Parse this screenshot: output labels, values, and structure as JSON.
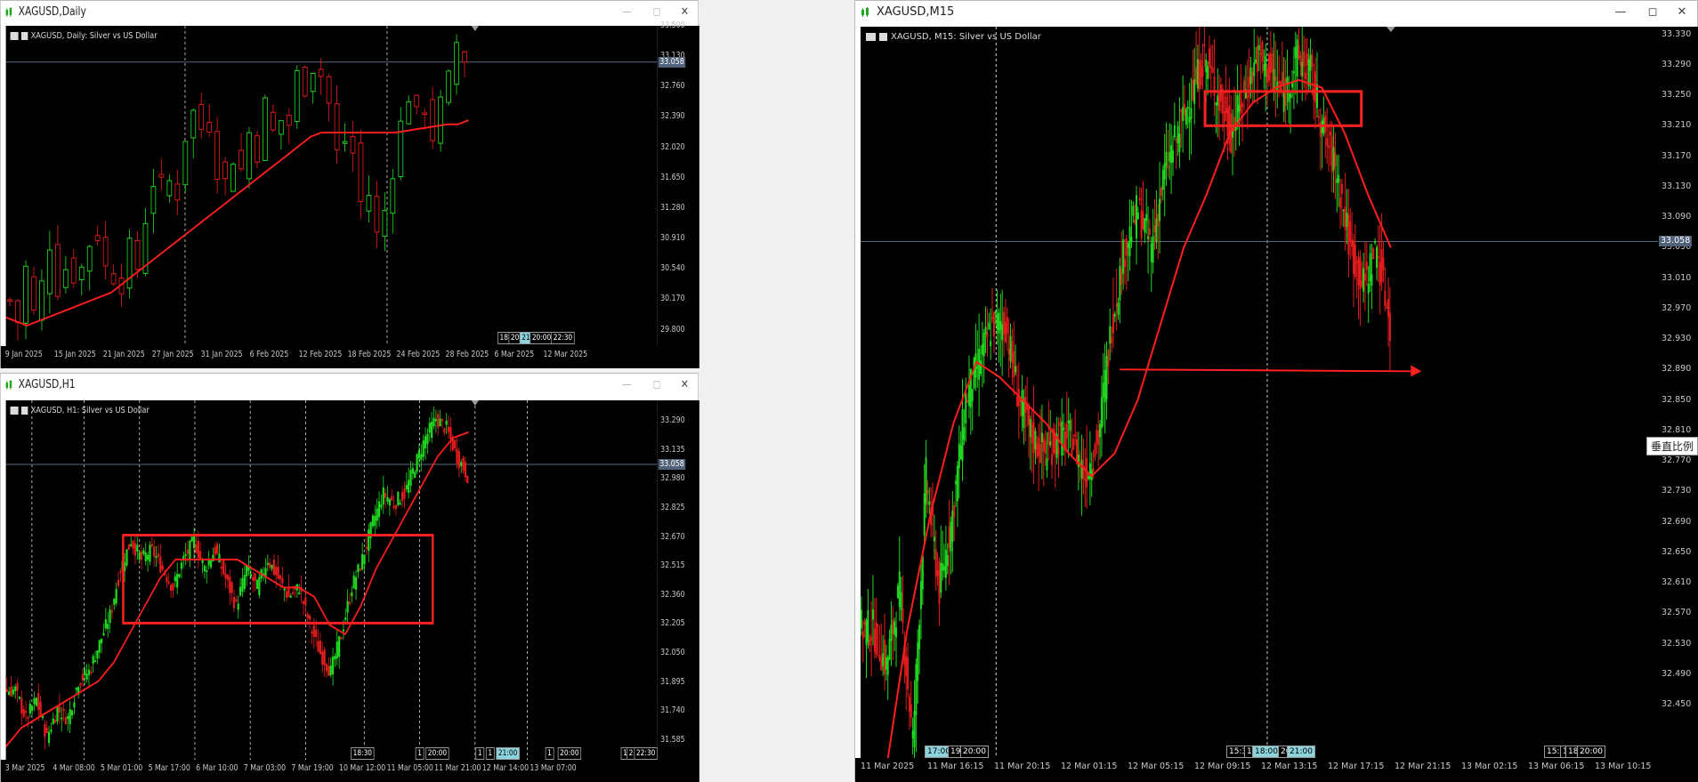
{
  "colors": {
    "bull": "#21d821",
    "bear": "#e21c1c",
    "ma": "#ff1e1e",
    "box": "#ff2020",
    "priceline": "#5a6a82"
  },
  "windows": {
    "daily": {
      "title": "XAGUSD,Daily",
      "symbol_label": "XAGUSD, Daily:  Silver vs US Dollar",
      "price_tag": "33.058",
      "y_ticks": [
        "33.500",
        "33.130",
        "32.760",
        "32.390",
        "32.020",
        "31.650",
        "31.280",
        "30.910",
        "30.540",
        "30.170",
        "29.800"
      ],
      "x_ticks": [
        "9 Jan 2025",
        "15 Jan 2025",
        "21 Jan 2025",
        "27 Jan 2025",
        "31 Jan 2025",
        "6 Feb 2025",
        "12 Feb 2025",
        "18 Feb 2025",
        "24 Feb 2025",
        "28 Feb 2025",
        "6 Mar 2025",
        "12 Mar 2025"
      ],
      "time_tags": [
        "18:",
        "20:",
        "21:",
        "20:00",
        "22:30"
      ]
    },
    "h1": {
      "title": "XAGUSD,H1",
      "symbol_label": "XAGUSD, H1:  Silver vs US Dollar",
      "price_tag": "33.058",
      "y_ticks": [
        "33.290",
        "33.135",
        "32.980",
        "32.825",
        "32.670",
        "32.515",
        "32.360",
        "32.205",
        "32.050",
        "31.895",
        "31.740",
        "31.585"
      ],
      "x_ticks": [
        "3 Mar 2025",
        "4 Mar 08:00",
        "5 Mar 01:00",
        "5 Mar 17:00",
        "6 Mar 10:00",
        "7 Mar 03:00",
        "7 Mar 19:00",
        "10 Mar 12:00",
        "11 Mar 05:00",
        "11 Mar 21:00",
        "12 Mar 14:00",
        "13 Mar 07:00"
      ],
      "time_tags": [
        "18:30",
        "1",
        "20:00",
        "1",
        "1",
        "21:00",
        "1",
        "20:00",
        "17",
        "2",
        "22:30"
      ]
    },
    "m15": {
      "title": "XAGUSD,M15",
      "symbol_label": "XAGUSD, M15:  Silver vs US Dollar",
      "price_tag": "33.058",
      "y_ticks": [
        "33.330",
        "33.290",
        "33.250",
        "33.210",
        "33.170",
        "33.130",
        "33.090",
        "33.050",
        "33.010",
        "32.970",
        "32.930",
        "32.890",
        "32.850",
        "32.810",
        "32.770",
        "32.730",
        "32.690",
        "32.650",
        "32.610",
        "32.570",
        "32.530",
        "32.490",
        "32.450"
      ],
      "x_ticks": [
        "11 Mar 2025",
        "11 Mar 16:15",
        "11 Mar 20:15",
        "12 Mar 01:15",
        "12 Mar 05:15",
        "12 Mar 09:15",
        "12 Mar 13:15",
        "12 Mar 17:15",
        "12 Mar 21:15",
        "13 Mar 02:15",
        "13 Mar 06:15",
        "13 Mar 10:15"
      ],
      "time_tags": [
        "17:00",
        "19:",
        "20:00",
        "15:30",
        "1",
        "18:00",
        "20:",
        "21:00",
        "15:30",
        "1",
        "18:30",
        "20:00"
      ],
      "tooltip": "垂直比例"
    }
  },
  "chart_data": [
    {
      "type": "candlestick",
      "symbol": "XAGUSD",
      "timeframe": "Daily",
      "y_range": [
        29.6,
        33.5
      ],
      "closes": [
        30.15,
        29.9,
        30.55,
        30.0,
        30.35,
        30.85,
        30.3,
        30.55,
        30.45,
        30.55,
        30.85,
        30.95,
        30.55,
        30.45,
        30.35,
        30.8,
        30.55,
        31.15,
        31.6,
        31.55,
        31.6,
        31.45,
        32.15,
        32.45,
        32.25,
        32.3,
        31.75,
        31.6,
        31.9,
        31.75,
        32.2,
        31.95,
        32.55,
        32.2,
        32.35,
        32.3,
        32.9,
        32.75,
        33.0,
        32.9,
        32.55,
        31.95,
        32.1,
        31.95,
        31.35,
        31.45,
        30.95,
        31.25,
        31.75,
        32.3,
        32.65,
        32.4,
        32.5,
        32.15,
        32.55,
        32.85,
        33.3,
        33.1
      ],
      "ma": [
        29.95,
        29.9,
        29.85,
        29.9,
        29.95,
        30.0,
        30.05,
        30.1,
        30.15,
        30.2,
        30.25,
        30.35,
        30.45,
        30.55,
        30.65,
        30.75,
        30.85,
        30.95,
        31.05,
        31.15,
        31.25,
        31.35,
        31.45,
        31.55,
        31.65,
        31.75,
        31.85,
        31.95,
        32.05,
        32.15,
        32.2,
        32.2,
        32.2,
        32.2,
        32.2,
        32.2,
        32.2,
        32.2,
        32.22,
        32.24,
        32.26,
        32.28,
        32.3,
        32.3,
        32.35
      ],
      "current_price": 33.058
    },
    {
      "type": "candlestick",
      "symbol": "XAGUSD",
      "timeframe": "H1",
      "y_range": [
        31.48,
        33.4
      ],
      "closes": [
        31.85,
        31.7,
        31.8,
        31.6,
        31.75,
        31.7,
        31.9,
        31.95,
        32.1,
        32.25,
        32.5,
        32.65,
        32.55,
        32.6,
        32.5,
        32.4,
        32.55,
        32.65,
        32.5,
        32.6,
        32.45,
        32.3,
        32.5,
        32.4,
        32.55,
        32.45,
        32.35,
        32.4,
        32.2,
        32.05,
        31.95,
        32.15,
        32.4,
        32.55,
        32.75,
        32.9,
        32.85,
        32.9,
        33.05,
        33.2,
        33.3,
        33.25,
        33.1,
        33.0
      ],
      "ma": [
        31.55,
        31.65,
        31.7,
        31.75,
        31.8,
        31.85,
        31.9,
        32.0,
        32.15,
        32.3,
        32.45,
        32.55,
        32.55,
        32.55,
        32.55,
        32.55,
        32.5,
        32.45,
        32.4,
        32.4,
        32.35,
        32.2,
        32.15,
        32.3,
        32.5,
        32.65,
        32.8,
        32.95,
        33.1,
        33.2,
        33.23
      ],
      "box": {
        "y_top": 32.68,
        "y_bottom": 32.21
      },
      "current_price": 33.058
    },
    {
      "type": "candlestick",
      "symbol": "XAGUSD",
      "timeframe": "M15",
      "y_range": [
        32.38,
        33.34
      ],
      "closes": [
        32.55,
        32.5,
        32.6,
        32.4,
        32.75,
        32.6,
        32.7,
        32.85,
        32.9,
        32.95,
        32.95,
        32.85,
        32.8,
        32.78,
        32.8,
        32.8,
        32.75,
        32.8,
        32.95,
        33.05,
        33.1,
        33.05,
        33.15,
        33.2,
        33.25,
        33.3,
        33.25,
        33.2,
        33.25,
        33.3,
        33.28,
        33.25,
        33.3,
        33.28,
        33.2,
        33.15,
        33.05,
        33.0,
        33.05,
        32.95
      ],
      "ma": [
        32.35,
        32.55,
        32.7,
        32.82,
        32.9,
        32.88,
        32.85,
        32.82,
        32.78,
        32.75,
        32.78,
        32.85,
        32.95,
        33.05,
        33.12,
        33.2,
        33.24,
        33.26,
        33.27,
        33.26,
        33.2,
        33.12,
        33.05
      ],
      "box": {
        "y_top": 33.255,
        "y_bottom": 33.21
      },
      "arrow_level": 32.89,
      "current_price": 33.058
    }
  ]
}
